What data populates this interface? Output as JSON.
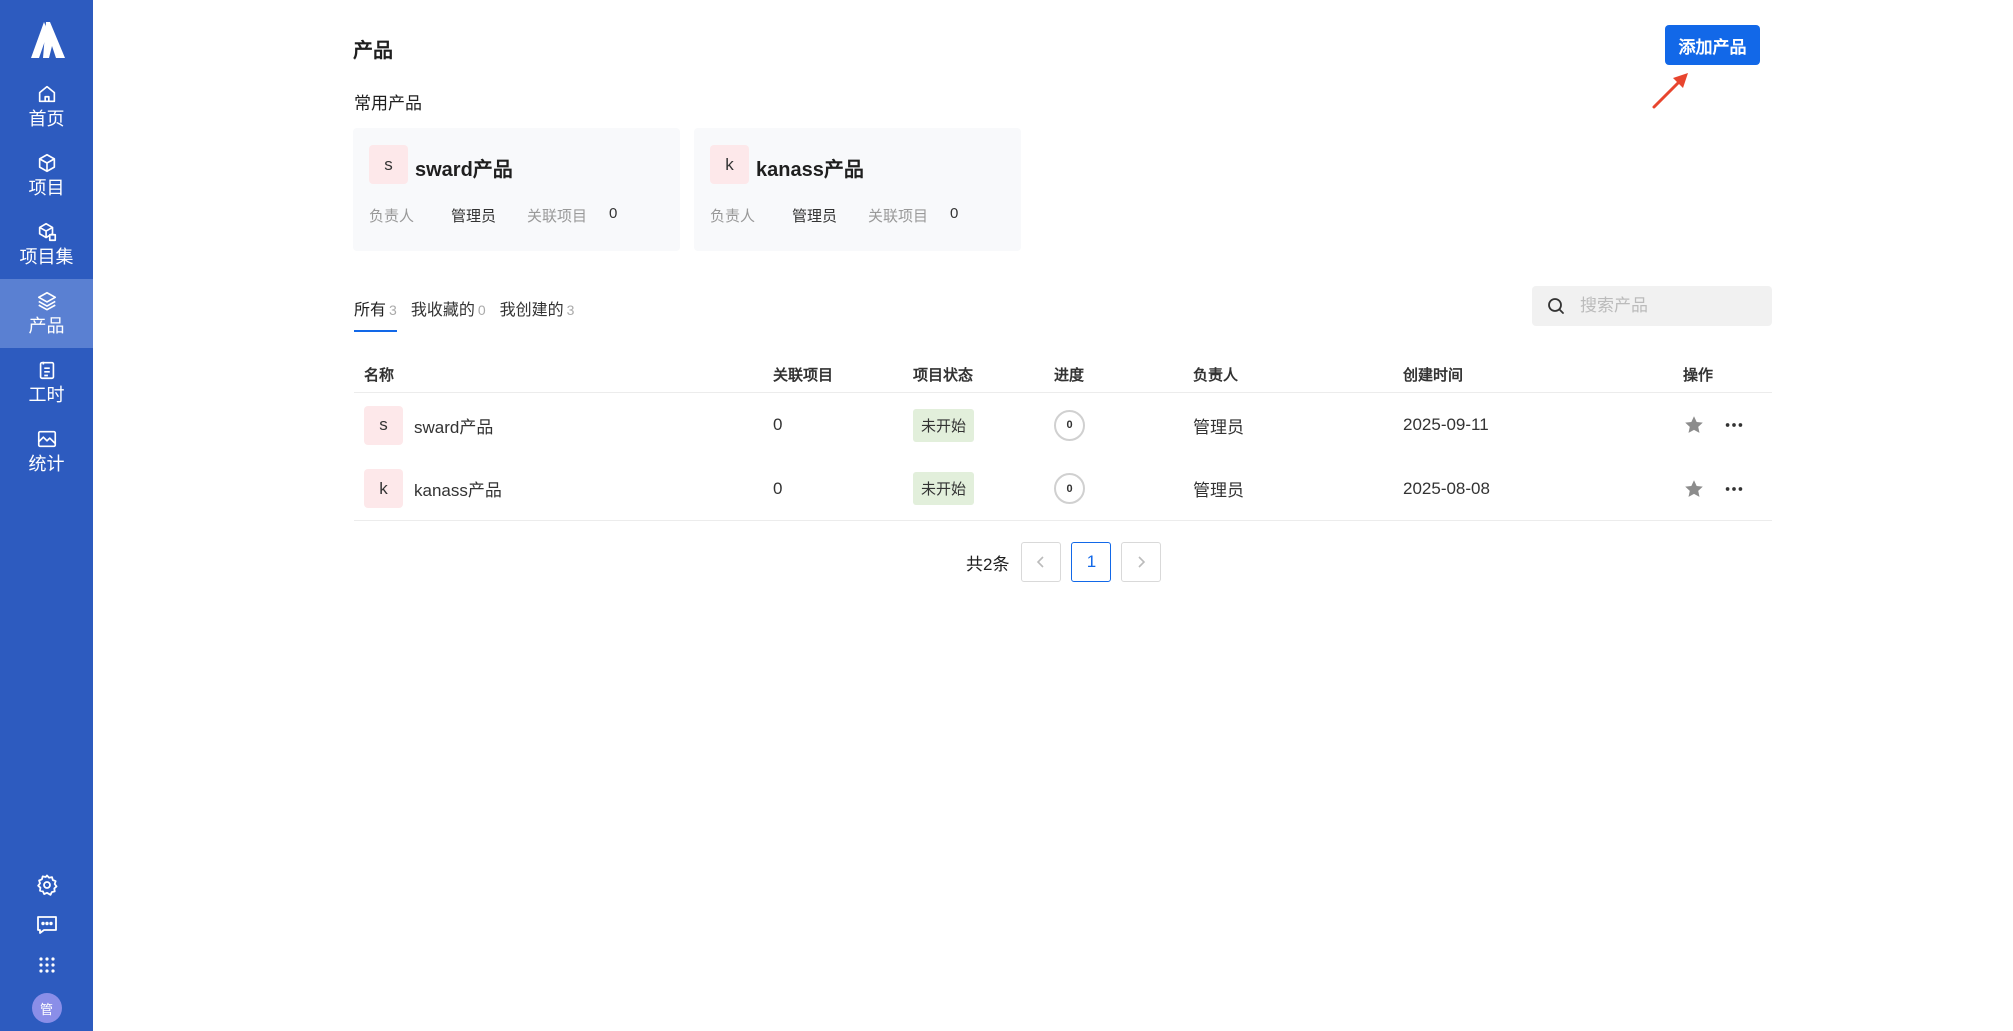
{
  "sidebar": {
    "items": [
      {
        "label": "首页",
        "icon": "home-icon"
      },
      {
        "label": "项目",
        "icon": "cube-icon"
      },
      {
        "label": "项目集",
        "icon": "cube-set-icon"
      },
      {
        "label": "产品",
        "icon": "layers-icon",
        "active": true
      },
      {
        "label": "工时",
        "icon": "timesheet-icon"
      },
      {
        "label": "统计",
        "icon": "chart-image-icon"
      }
    ],
    "bottom_icons": [
      "gear-icon",
      "message-icon",
      "apps-grid-icon"
    ],
    "avatar_text": "管"
  },
  "header": {
    "title": "产品",
    "add_button": "添加产品"
  },
  "frequent": {
    "label": "常用产品",
    "cards": [
      {
        "initial": "s",
        "name": "sward产品",
        "owner_label": "负责人",
        "owner": "管理员",
        "projects_label": "关联项目",
        "projects": "0"
      },
      {
        "initial": "k",
        "name": "kanass产品",
        "owner_label": "负责人",
        "owner": "管理员",
        "projects_label": "关联项目",
        "projects": "0"
      }
    ]
  },
  "tabs": [
    {
      "label": "所有",
      "count": "3",
      "active": true
    },
    {
      "label": "我收藏的",
      "count": "0"
    },
    {
      "label": "我创建的",
      "count": "3"
    }
  ],
  "search": {
    "placeholder": "搜索产品"
  },
  "table": {
    "headers": {
      "name": "名称",
      "projects": "关联项目",
      "status": "项目状态",
      "progress": "进度",
      "owner": "负责人",
      "created": "创建时间",
      "ops": "操作"
    },
    "rows": [
      {
        "initial": "s",
        "name": "sward产品",
        "projects": "0",
        "status": "未开始",
        "progress": "0",
        "owner": "管理员",
        "created": "2025-09-11"
      },
      {
        "initial": "k",
        "name": "kanass产品",
        "projects": "0",
        "status": "未开始",
        "progress": "0",
        "owner": "管理员",
        "created": "2025-08-08"
      }
    ]
  },
  "pagination": {
    "total": "共2条",
    "current": "1",
    "prev": "‹",
    "next": "›"
  },
  "colors": {
    "sidebar": "#2d5bbf",
    "sidebar_active": "#5a80d2",
    "primary": "#1268e8",
    "arrow": "#e8452e",
    "tag_bg": "#e2efdb",
    "icon_bg": "#fde8ea"
  }
}
